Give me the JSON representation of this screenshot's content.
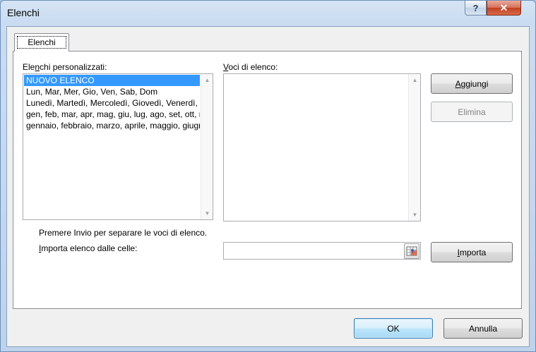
{
  "window": {
    "title": "Elenchi",
    "help_glyph": "?",
    "close_glyph": "✕"
  },
  "tabs": [
    {
      "label": "Elenchi",
      "selected": true
    }
  ],
  "custom_lists": {
    "label_pre": "Ele",
    "label_accel": "n",
    "label_post": "chi personalizzati:",
    "items": [
      "NUOVO ELENCO",
      "Lun, Mar, Mer, Gio, Ven, Sab, Dom",
      "Lunedì, Martedì, Mercoledì, Giovedì, Venerdì, Sabato, Domenica",
      "gen, feb, mar, apr, mag, giu, lug, ago, set, ott, nov, dic",
      "gennaio, febbraio, marzo, aprile, maggio, giugno, luglio, agosto, settembre, ottobre, novembre, dicembre"
    ],
    "selected_index": 0
  },
  "list_entries": {
    "label_accel": "V",
    "label_post": "oci di elenco:",
    "value": ""
  },
  "buttons": {
    "add_accel": "A",
    "add_post": "ggiungi",
    "delete": "Elimina",
    "import_accel": "I",
    "import_post": "mporta",
    "ok": "OK",
    "cancel": "Annulla"
  },
  "hint_text": "Premere Invio per separare le voci di elenco.",
  "import_from_cells": {
    "label_accel": "I",
    "label_post": "mporta elenco dalle celle:",
    "value": ""
  },
  "colors": {
    "selection": "#3399ff",
    "title_bar": "#c9dcf1",
    "close_button": "#c2401f"
  }
}
